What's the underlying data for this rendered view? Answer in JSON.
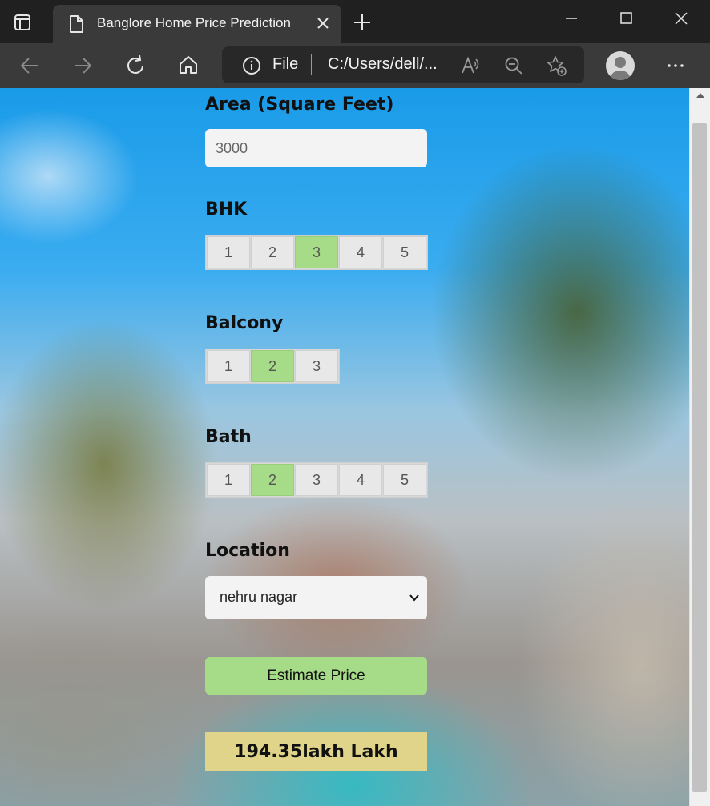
{
  "browser": {
    "tab_title": "Banglore Home Price Prediction",
    "address_scheme": "File",
    "address_url": "C:/Users/dell/..."
  },
  "form": {
    "area": {
      "label": "Area (Square Feet)",
      "value": "3000"
    },
    "bhk": {
      "label": "BHK",
      "options": [
        "1",
        "2",
        "3",
        "4",
        "5"
      ],
      "selected": "3"
    },
    "balcony": {
      "label": "Balcony",
      "options": [
        "1",
        "2",
        "3"
      ],
      "selected": "2"
    },
    "bath": {
      "label": "Bath",
      "options": [
        "1",
        "2",
        "3",
        "4",
        "5"
      ],
      "selected": "2"
    },
    "location": {
      "label": "Location",
      "selected": "nehru nagar"
    },
    "estimate_button": "Estimate Price",
    "result": "194.35lakh Lakh"
  },
  "colors": {
    "accent_green": "#a6dc87",
    "result_bg": "#dfd489"
  },
  "icons": [
    "tab-actions-icon",
    "page-icon",
    "close-icon",
    "plus-icon",
    "minimize-icon",
    "maximize-icon",
    "back-icon",
    "forward-icon",
    "refresh-icon",
    "home-icon",
    "info-icon",
    "read-aloud-icon",
    "zoom-out-icon",
    "favorites-icon",
    "profile-icon",
    "more-icon",
    "chevron-down-icon"
  ]
}
